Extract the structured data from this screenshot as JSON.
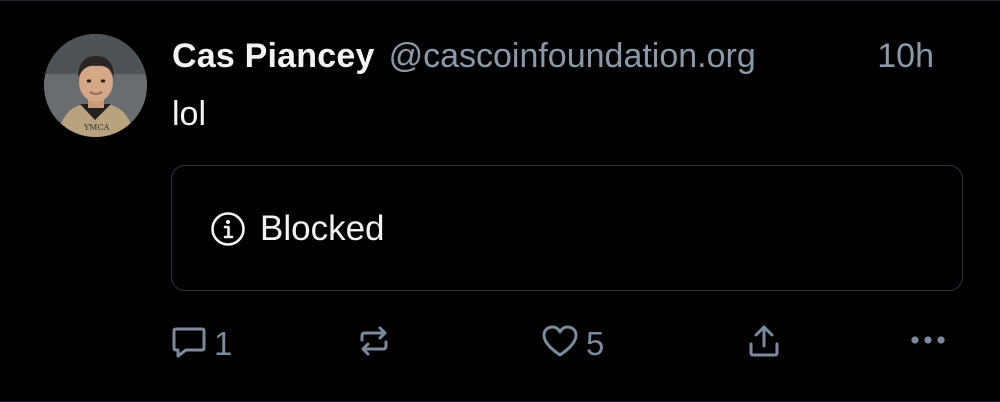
{
  "post": {
    "author": {
      "display_name": "Cas Piancey",
      "handle": "@cascoinfoundation.org"
    },
    "timestamp": "10h",
    "text": "lol",
    "embed": {
      "status_label": "Blocked",
      "icon": "info-icon"
    },
    "actions": {
      "reply_count": "1",
      "like_count": "5",
      "icons": [
        "reply-icon",
        "repost-icon",
        "like-icon",
        "share-icon",
        "more-icon"
      ]
    }
  },
  "colors": {
    "background": "#000000",
    "primary_text": "#f1f3f5",
    "secondary_text": "#8b98a9",
    "action_icons": "#7b8a9d",
    "embed_border": "#2c3441"
  }
}
